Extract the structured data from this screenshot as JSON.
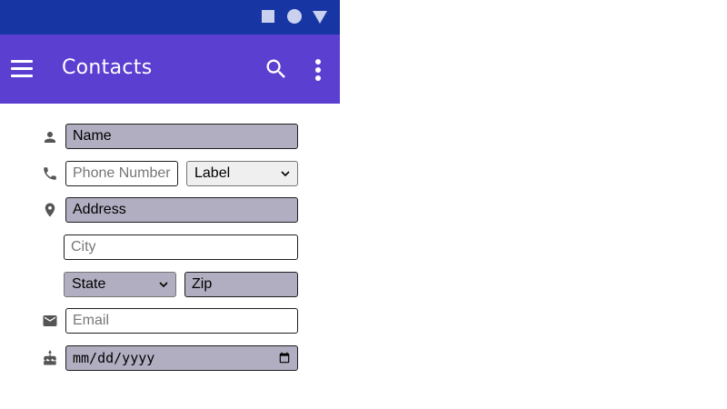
{
  "status_bar": {
    "icons": [
      "square-nav-icon",
      "circle-nav-icon",
      "triangle-nav-icon"
    ]
  },
  "app_bar": {
    "title": "Contacts",
    "background": "#5b3fd1",
    "icons": [
      "menu-icon",
      "search-icon",
      "more-vert-icon"
    ]
  },
  "form": {
    "name": {
      "value": "Name",
      "icon": "person-icon"
    },
    "phone": {
      "placeholder": "Phone Number",
      "icon": "phone-icon"
    },
    "phone_label": {
      "selected": "Label"
    },
    "address": {
      "value": "Address",
      "icon": "location-pin-icon"
    },
    "city": {
      "placeholder": "City"
    },
    "state": {
      "selected": "State"
    },
    "zip": {
      "value": "Zip"
    },
    "email": {
      "placeholder": "Email",
      "icon": "email-icon"
    },
    "birthday": {
      "placeholder": "mm/dd/yyyy",
      "icon": "cake-icon"
    }
  },
  "colors": {
    "status_bar": "#1736a3",
    "filled_field": "#b0aec0"
  }
}
